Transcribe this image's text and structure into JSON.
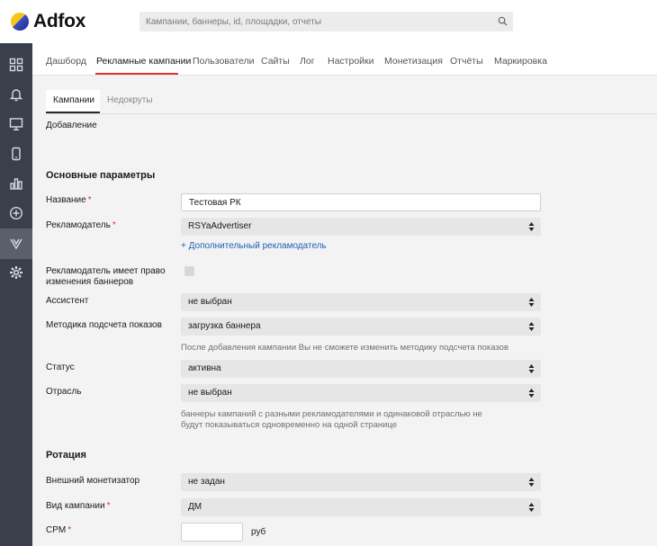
{
  "brand": {
    "name": "Adfox"
  },
  "search": {
    "placeholder": "Кампании, баннеры, id, площадки, отчеты"
  },
  "nav_tabs": [
    "Дашборд",
    "Рекламные кампании",
    "Пользователи",
    "Сайты",
    "Лог",
    "Настройки",
    "Монетизация",
    "Отчёты",
    "Маркировка"
  ],
  "active_tab": "Рекламные кампании",
  "sub_tabs": [
    "Кампании",
    "Недокруты"
  ],
  "page_title": "Добавление",
  "sidebar_icons": [
    "dashboard-grid-icon",
    "bell-icon",
    "monitor-icon",
    "mobile-phone-icon",
    "bar-chart-icon",
    "plus-circle-icon",
    "marking-icon",
    "gear-icon"
  ],
  "sections": {
    "main": "Основные параметры",
    "rotation": "Ротация"
  },
  "fields": {
    "name": {
      "label": "Название",
      "value": "Тестовая РК"
    },
    "advertiser": {
      "label": "Рекламодатель",
      "value": "RSYaAdvertiser",
      "add_link": "+ Дополнительный рекламодатель"
    },
    "advertiser_can_edit": {
      "label": "Рекламодатель имеет право изменения баннеров"
    },
    "assistant": {
      "label": "Ассистент",
      "value": "не выбран"
    },
    "impression_method": {
      "label": "Методика подсчета показов",
      "value": "загрузка баннера",
      "hint": "После добавления кампании Вы не сможете изменить методику подсчета показов"
    },
    "status": {
      "label": "Статус",
      "value": "активна"
    },
    "industry": {
      "label": "Отрасль",
      "value": "не выбран",
      "hint": "баннеры кампаний с разными рекламодателями и одинаковой отраслью не будут показываться одновременно на одной странице"
    },
    "external_monetizer": {
      "label": "Внешний монетизатор",
      "value": "не задан"
    },
    "campaign_type": {
      "label": "Вид кампании",
      "value": "ДМ"
    },
    "cpm": {
      "label": "CPM",
      "value": "",
      "unit": "руб"
    }
  },
  "colors": {
    "accent": "#e0332a",
    "link": "#1e5fb8",
    "sidebar": "#3a3f4b"
  }
}
